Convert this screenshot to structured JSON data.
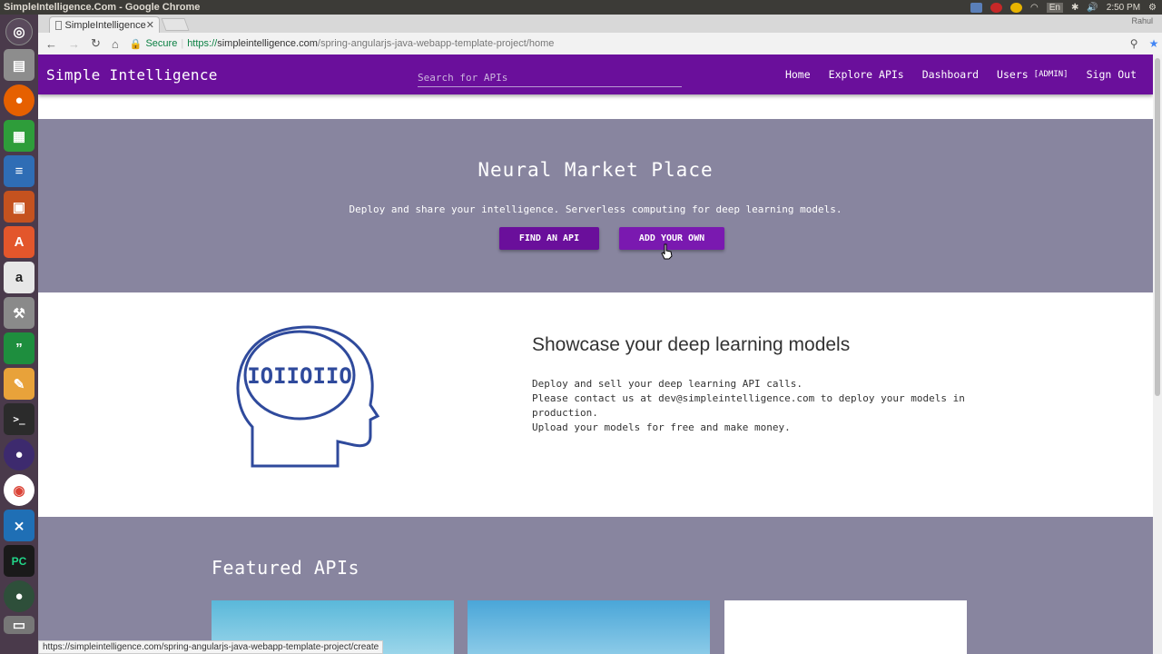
{
  "os": {
    "window_title": "SimpleIntelligence.Com - Google Chrome",
    "keyboard_layout": "En",
    "clock": "2:50 PM"
  },
  "browser": {
    "tab_title": "SimpleIntelligence",
    "profile_name": "Rahul",
    "secure_label": "Secure",
    "url_scheme": "https://",
    "url_host": "simpleintelligence.com",
    "url_path": "/spring-angularjs-java-webapp-template-project/home",
    "status_url": "https://simpleintelligence.com/spring-angularjs-java-webapp-template-project/create"
  },
  "header": {
    "brand": "Simple Intelligence",
    "search_placeholder": "Search for APIs",
    "nav": {
      "home": "Home",
      "explore": "Explore APIs",
      "dashboard": "Dashboard",
      "users": "Users",
      "admin_badge": "[ADMIN]",
      "signout": "Sign Out"
    }
  },
  "hero": {
    "title": "Neural Market Place",
    "subtitle": "Deploy and share your intelligence. Serverless computing for deep learning models.",
    "find_button": "FIND AN API",
    "add_button": "ADD YOUR OWN"
  },
  "showcase": {
    "icon_text": "IOIIOIIO",
    "title": "Showcase your deep learning models",
    "line1": "Deploy and sell your deep learning API calls.",
    "line2": "Please contact us at dev@simpleintelligence.com to deploy your models in production.",
    "line3": "Upload your models for free and make money."
  },
  "featured": {
    "title": "Featured APIs"
  },
  "colors": {
    "primary": "#6a0f9b",
    "hero_bg": "#88859f"
  }
}
